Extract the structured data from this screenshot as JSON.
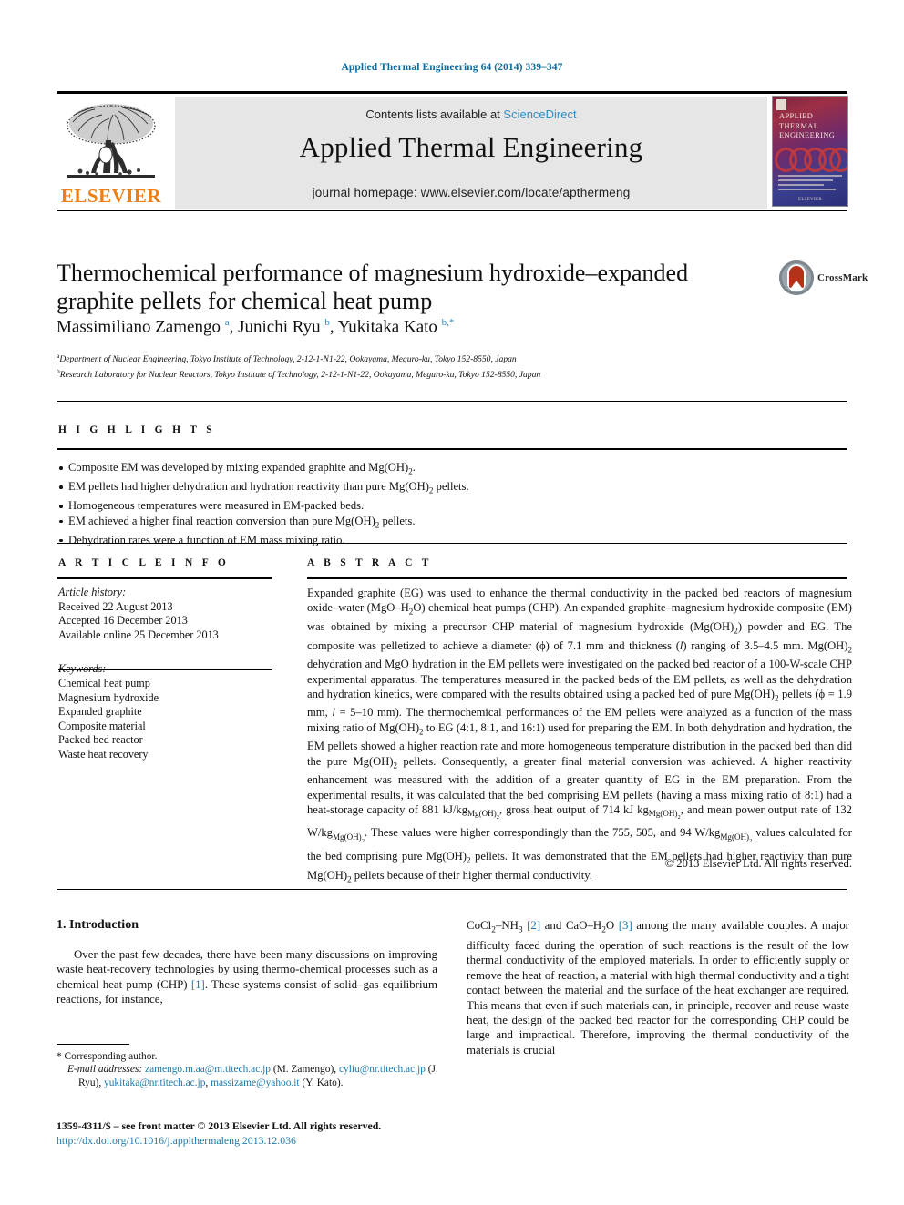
{
  "running_head": "Applied Thermal Engineering 64 (2014) 339–347",
  "masthead": {
    "publisher_name": "ELSEVIER",
    "contents_prefix": "Contents lists available at ",
    "sciencedirect": "ScienceDirect",
    "journal_name": "Applied Thermal Engineering",
    "homepage": "journal homepage: www.elsevier.com/locate/apthermeng",
    "cover": {
      "line1": "APPLIED",
      "line2": "THERMAL",
      "line3": "ENGINEERING",
      "footer": "ELSEVIER"
    }
  },
  "article": {
    "title": "Thermochemical performance of magnesium hydroxide–expanded graphite pellets for chemical heat pump",
    "crossmark_label": "CrossMark",
    "authors_html": "Massimiliano Zamengo <sup>a</sup>, Junichi Ryu <sup>b</sup>, Yukitaka Kato <sup>b,</sup><sup>*</sup>",
    "affiliations": [
      "Department of Nuclear Engineering, Tokyo Institute of Technology, 2-12-1-N1-22, Ookayama, Meguro-ku, Tokyo 152-8550, Japan",
      "Research Laboratory for Nuclear Reactors, Tokyo Institute of Technology, 2-12-1-N1-22, Ookayama, Meguro-ku, Tokyo 152-8550, Japan"
    ],
    "affiliation_marks": [
      "a",
      "b"
    ]
  },
  "highlights": {
    "heading": "H I G H L I G H T S",
    "items_html": [
      "Composite EM was developed by mixing expanded graphite and Mg(OH)<sub>2</sub>.",
      "EM pellets had higher dehydration and hydration reactivity than pure Mg(OH)<sub>2</sub> pellets.",
      "Homogeneous temperatures were measured in EM-packed beds.",
      "EM achieved a higher final reaction conversion than pure Mg(OH)<sub>2</sub> pellets.",
      "Dehydration rates were a function of EM mass mixing ratio."
    ]
  },
  "article_info": {
    "heading": "A R T I C L E  I N F O",
    "history_label": "Article history:",
    "history": [
      "Received 22 August 2013",
      "Accepted 16 December 2013",
      "Available online 25 December 2013"
    ],
    "keywords_label": "Keywords:",
    "keywords": [
      "Chemical heat pump",
      "Magnesium hydroxide",
      "Expanded graphite",
      "Composite material",
      "Packed bed reactor",
      "Waste heat recovery"
    ]
  },
  "abstract": {
    "heading": "A B S T R A C T",
    "body_html": "Expanded graphite (EG) was used to enhance the thermal conductivity in the packed bed reactors of magnesium oxide–water (MgO–H<sub>2</sub>O) chemical heat pumps (CHP). An expanded graphite–magnesium hydroxide composite (EM) was obtained by mixing a precursor CHP material of magnesium hydroxide (Mg(OH)<sub>2</sub>) powder and EG. The composite was pelletized to achieve a diameter (ϕ) of 7.1 mm and thickness (<i>l</i>) ranging of 3.5–4.5 mm. Mg(OH)<sub>2</sub> dehydration and MgO hydration in the EM pellets were investigated on the packed bed reactor of a 100-W-scale CHP experimental apparatus. The temperatures measured in the packed beds of the EM pellets, as well as the dehydration and hydration kinetics, were compared with the results obtained using a packed bed of pure Mg(OH)<sub>2</sub> pellets (ϕ = 1.9 mm, <i>l</i> = 5–10 mm). The thermochemical performances of the EM pellets were analyzed as a function of the mass mixing ratio of Mg(OH)<sub>2</sub> to EG (4:1, 8:1, and 16:1) used for preparing the EM. In both dehydration and hydration, the EM pellets showed a higher reaction rate and more homogeneous temperature distribution in the packed bed than did the pure Mg(OH)<sub>2</sub> pellets. Consequently, a greater final material conversion was achieved. A higher reactivity enhancement was measured with the addition of a greater quantity of EG in the EM preparation. From the experimental results, it was calculated that the bed comprising EM pellets (having a mass mixing ratio of 8:1) had a heat-storage capacity of 881 kJ/kg<sub>Mg(OH)<sub>2</sub></sub>, gross heat output of 714 kJ kg<sub>Mg(OH)<sub>2</sub></sub>, and mean power output rate of 132 W/kg<sub>Mg(OH)<sub>2</sub></sub>. These values were higher correspondingly than the 755, 505, and 94 W/kg<sub>Mg(OH)<sub>2</sub></sub> values calculated for the bed comprising pure Mg(OH)<sub>2</sub> pellets. It was demonstrated that the EM pellets had higher reactivity than pure Mg(OH)<sub>2</sub> pellets because of their higher thermal conductivity.",
    "copyright": "© 2013 Elsevier Ltd. All rights reserved."
  },
  "introduction": {
    "heading": "1.  Introduction",
    "left_paragraph_html": "Over the past few decades, there have been many discussions on improving waste heat-recovery technologies by using thermo-chemical processes such as a chemical heat pump (CHP) <span class=\"lnk\">[1]</span>. These systems consist of solid–gas equilibrium reactions, for instance,",
    "right_paragraph_html": "CoCl<sub>2</sub>–NH<sub>3</sub> <span class=\"lnk\">[2]</span> and CaO–H<sub>2</sub>O <span class=\"lnk\">[3]</span> among the many available couples. A major difficulty faced during the operation of such reactions is the result of the low thermal conductivity of the employed materials. In order to efficiently supply or remove the heat of reaction, a material with high thermal conductivity and a tight contact between the material and the surface of the heat exchanger are required. This means that even if such materials can, in principle, recover and reuse waste heat, the design of the packed bed reactor for the corresponding CHP could be large and impractical. Therefore, improving the thermal conductivity of the materials is crucial"
  },
  "footnote": {
    "corresponding_html": "* Corresponding author.",
    "emails_html": "<span class=\"ital\">E-mail addresses:</span> <span class=\"lnk\">zamengo.m.aa@m.titech.ac.jp</span> (M. Zamengo), <span class=\"lnk\">cyliu@nr.titech.ac.jp</span> (J. Ryu), <span class=\"lnk\">yukitaka@nr.titech.ac.jp</span>, <span class=\"lnk\">massizame@yahoo.it</span> (Y. Kato).",
    "issn_html": "1359-4311/$ – see front matter © 2013 Elsevier Ltd. All rights reserved.",
    "doi": "http://dx.doi.org/10.1016/j.applthermaleng.2013.12.036"
  },
  "colors": {
    "link": "#1a7aad",
    "running_head": "#0b6ca0",
    "elsevier_orange": "#f07f13",
    "band_gray": "#e6e6e6"
  }
}
